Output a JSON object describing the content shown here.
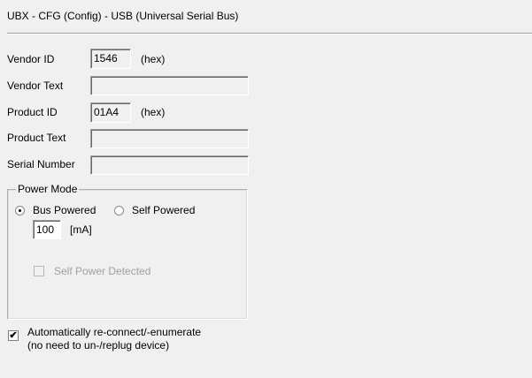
{
  "title": "UBX - CFG (Config) - USB (Universal Serial Bus)",
  "fields": {
    "vendor_id": {
      "label": "Vendor ID",
      "value": "1546",
      "unit": "(hex)"
    },
    "vendor_text": {
      "label": "Vendor Text",
      "value": ""
    },
    "product_id": {
      "label": "Product ID",
      "value": "01A4",
      "unit": "(hex)"
    },
    "product_text": {
      "label": "Product Text",
      "value": ""
    },
    "serial_number": {
      "label": "Serial Number",
      "value": ""
    }
  },
  "power_mode": {
    "legend": "Power Mode",
    "bus_powered": {
      "label": "Bus Powered",
      "selected": true
    },
    "self_powered": {
      "label": "Self Powered",
      "selected": false
    },
    "current": {
      "value": "100",
      "unit": "[mA]"
    },
    "self_power_detected": {
      "label": "Self Power Detected",
      "checked": false,
      "disabled": true
    }
  },
  "auto_reconnect": {
    "line1": "Automatically re-connect/-enumerate",
    "line2": "(no need to un-/replug device)",
    "checked": true
  }
}
